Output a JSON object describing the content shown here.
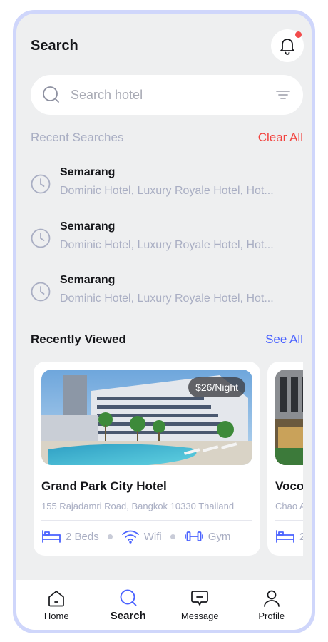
{
  "header": {
    "title": "Search"
  },
  "search": {
    "placeholder": "Search hotel"
  },
  "recent": {
    "title": "Recent Searches",
    "clear_label": "Clear All",
    "items": [
      {
        "city": "Semarang",
        "hotels": "Dominic Hotel, Luxury Royale Hotel, Hot..."
      },
      {
        "city": "Semarang",
        "hotels": "Dominic Hotel, Luxury Royale Hotel, Hot..."
      },
      {
        "city": "Semarang",
        "hotels": "Dominic Hotel, Luxury Royale Hotel, Hot..."
      }
    ]
  },
  "viewed": {
    "title": "Recently Viewed",
    "see_all_label": "See All",
    "cards": [
      {
        "price": "$26/Night",
        "name": "Grand Park City Hotel",
        "address": "155 Rajadamri Road, Bangkok 10330 Thailand",
        "amenities": [
          "2 Beds",
          "Wifi",
          "Gym"
        ]
      },
      {
        "name": "Voco",
        "address": "Chao A",
        "amenities": [
          "2"
        ]
      }
    ]
  },
  "tabs": [
    {
      "label": "Home",
      "icon": "home-icon"
    },
    {
      "label": "Search",
      "icon": "search-icon"
    },
    {
      "label": "Message",
      "icon": "message-icon"
    },
    {
      "label": "Profile",
      "icon": "profile-icon"
    }
  ],
  "colors": {
    "accent": "#4a62ff",
    "danger": "#f2423e",
    "muted": "#a9aec3",
    "frame": "#cfd6fb",
    "background": "#eeeff0"
  }
}
